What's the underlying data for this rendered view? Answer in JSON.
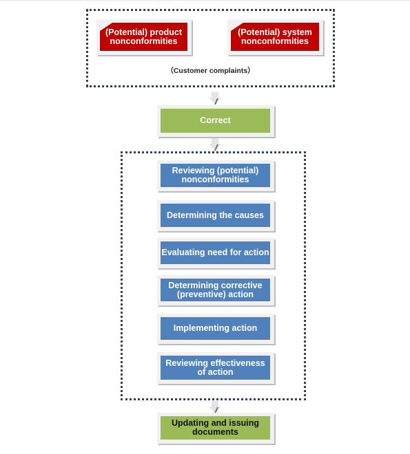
{
  "inputs": {
    "product": "(Potential) product nonconformities",
    "system": "(Potential) system nonconformities",
    "note": "（Customer complaints）"
  },
  "correct": "Correct",
  "steps": [
    "Reviewing (potential) nonconformities",
    "Determining the causes",
    "Evaluating need for action",
    "Determining corrective (preventive) action",
    "Implementing action",
    "Reviewing effectiveness of action"
  ],
  "final": "Updating and issuing documents",
  "colors": {
    "red": "#c00000",
    "green": "#9bbb59",
    "blue": "#4f81bd",
    "dotted_border": "#2f3f5f"
  }
}
